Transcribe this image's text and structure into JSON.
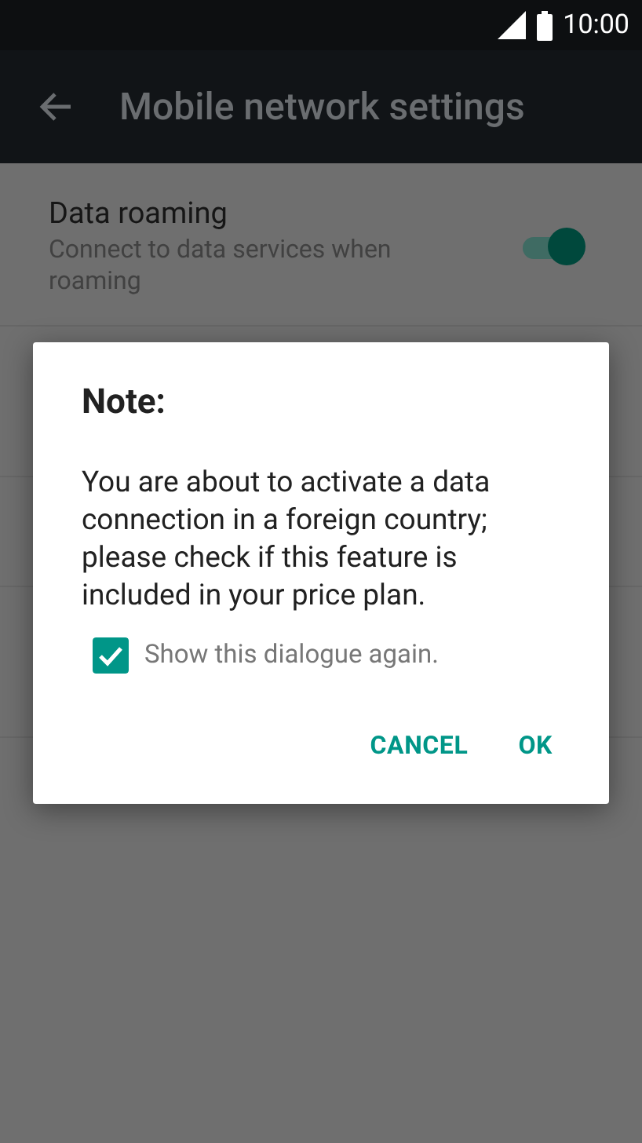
{
  "status_bar": {
    "time": "10:00"
  },
  "app_bar": {
    "title": "Mobile network settings"
  },
  "settings": [
    {
      "kind": "toggle",
      "title": "Data roaming",
      "summary": "Connect to data services when roaming",
      "on": true
    }
  ],
  "dialog": {
    "title": "Note:",
    "message": "You are about to activate a data connection in a foreign country; please check if this feature is included in your price plan.",
    "checkbox": {
      "label": "Show this dialogue again.",
      "checked": true
    },
    "buttons": [
      "CANCEL",
      "OK"
    ]
  }
}
